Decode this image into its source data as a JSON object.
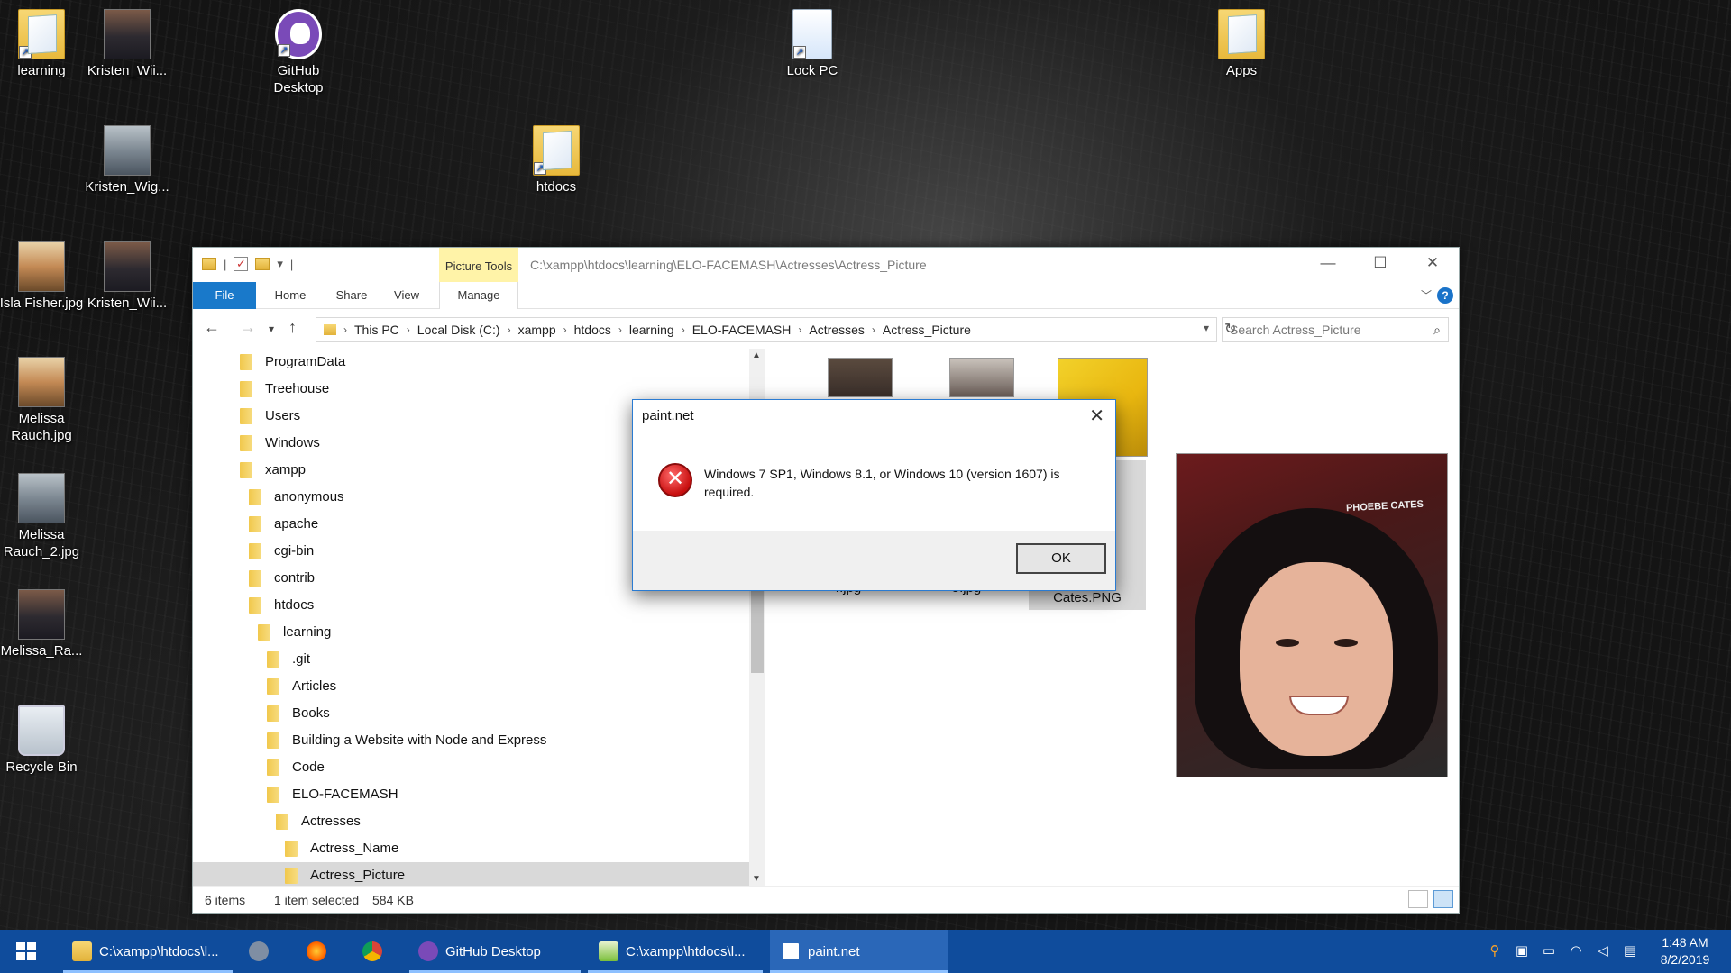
{
  "desktop": {
    "icons": [
      {
        "label": "learning"
      },
      {
        "label": "Kristen_Wii..."
      },
      {
        "label": "GitHub Desktop"
      },
      {
        "label": "Lock PC"
      },
      {
        "label": "Apps"
      },
      {
        "label": "Kristen_Wig..."
      },
      {
        "label": "htdocs"
      },
      {
        "label": "Isla Fisher.jpg"
      },
      {
        "label": "Kristen_Wii..."
      },
      {
        "label": "Melissa Rauch.jpg"
      },
      {
        "label": "Melissa Rauch_2.jpg"
      },
      {
        "label": "Melissa_Ra..."
      },
      {
        "label": "Recycle Bin"
      }
    ]
  },
  "explorer": {
    "title_path": "C:\\xampp\\htdocs\\learning\\ELO-FACEMASH\\Actresses\\Actress_Picture",
    "contextual_group": "Picture Tools",
    "tabs": {
      "file": "File",
      "home": "Home",
      "share": "Share",
      "view": "View",
      "manage": "Manage"
    },
    "breadcrumb": [
      "This PC",
      "Local Disk (C:)",
      "xampp",
      "htdocs",
      "learning",
      "ELO-FACEMASH",
      "Actresses",
      "Actress_Picture"
    ],
    "search_placeholder": "Search Actress_Picture",
    "tree": [
      {
        "label": "ProgramData"
      },
      {
        "label": "Treehouse"
      },
      {
        "label": "Users"
      },
      {
        "label": "Windows"
      },
      {
        "label": "xampp"
      },
      {
        "label": "anonymous"
      },
      {
        "label": "apache"
      },
      {
        "label": "cgi-bin"
      },
      {
        "label": "contrib"
      },
      {
        "label": "htdocs"
      },
      {
        "label": "learning"
      },
      {
        "label": ".git"
      },
      {
        "label": "Articles"
      },
      {
        "label": "Books"
      },
      {
        "label": "Building a Website with Node and Express"
      },
      {
        "label": "Code"
      },
      {
        "label": "ELO-FACEMASH"
      },
      {
        "label": "Actresses"
      },
      {
        "label": "Actress_Name"
      },
      {
        "label": "Actress_Picture"
      }
    ],
    "files": [
      {
        "name": "4.jpg"
      },
      {
        "name": "5.jpg"
      },
      {
        "name": "Phoebe Cates.PNG"
      }
    ],
    "preview_caption": "PHOEBE CATES",
    "status": {
      "items": "6 items",
      "selected": "1 item selected",
      "size": "584 KB"
    }
  },
  "dialog": {
    "title": "paint.net",
    "message": "Windows 7 SP1, Windows 8.1, or Windows 10 (version 1607) is required.",
    "ok": "OK"
  },
  "taskbar": {
    "items": [
      {
        "label": "C:\\xampp\\htdocs\\l..."
      },
      {
        "label": "GitHub Desktop"
      },
      {
        "label": "C:\\xampp\\htdocs\\l..."
      },
      {
        "label": "paint.net"
      }
    ],
    "time": "1:48 AM",
    "date": "8/2/2019"
  },
  "colors": {
    "taskbar": "#0f4c9c",
    "file_tab": "#1979ca",
    "picture_tools": "#fff3a8",
    "error": "#c80f0f"
  }
}
